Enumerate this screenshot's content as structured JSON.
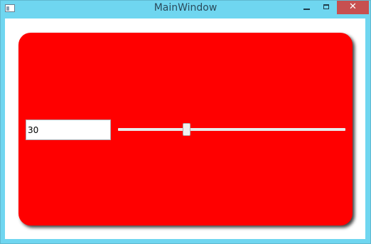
{
  "window": {
    "title": "MainWindow",
    "frame_color": "#6fd6f0",
    "close_button_color": "#c75050",
    "icon": "app-window-icon",
    "controls": {
      "minimize_icon": "minimize-icon",
      "maximize_icon": "maximize-icon",
      "close_icon": "close-icon",
      "close_glyph": "✕"
    }
  },
  "panel": {
    "background_color": "#ff0000"
  },
  "input": {
    "value": "30"
  },
  "slider": {
    "value_fraction": 0.3,
    "track_color": "#e7eaea"
  }
}
